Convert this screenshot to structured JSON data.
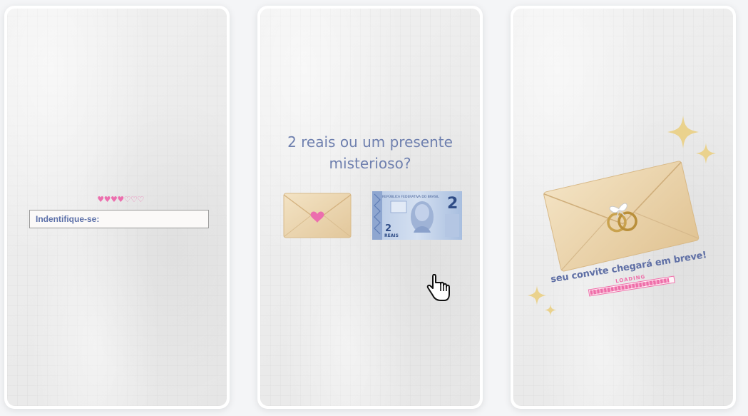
{
  "card1": {
    "hearts": [
      "♥",
      "♥",
      "♥",
      "♥",
      "♡",
      "♡",
      "♡"
    ],
    "identify_label": "Indentifique-se:"
  },
  "card2": {
    "question_line1": "2 reais ou um presente",
    "question_line2": "misterioso?",
    "banknote": {
      "header": "REPÚBLICA FEDERATIVA DO BRASIL",
      "value": "2",
      "currency": "REAIS"
    }
  },
  "card3": {
    "caption": "seu convite chegará em breve!",
    "loading_label": "LOADING",
    "loading_progress": 0.95
  },
  "colors": {
    "accent_blue": "#6e7fae",
    "accent_pink": "#ec6fae",
    "envelope": "#e9d3ad",
    "gold": "#e8cf86"
  }
}
